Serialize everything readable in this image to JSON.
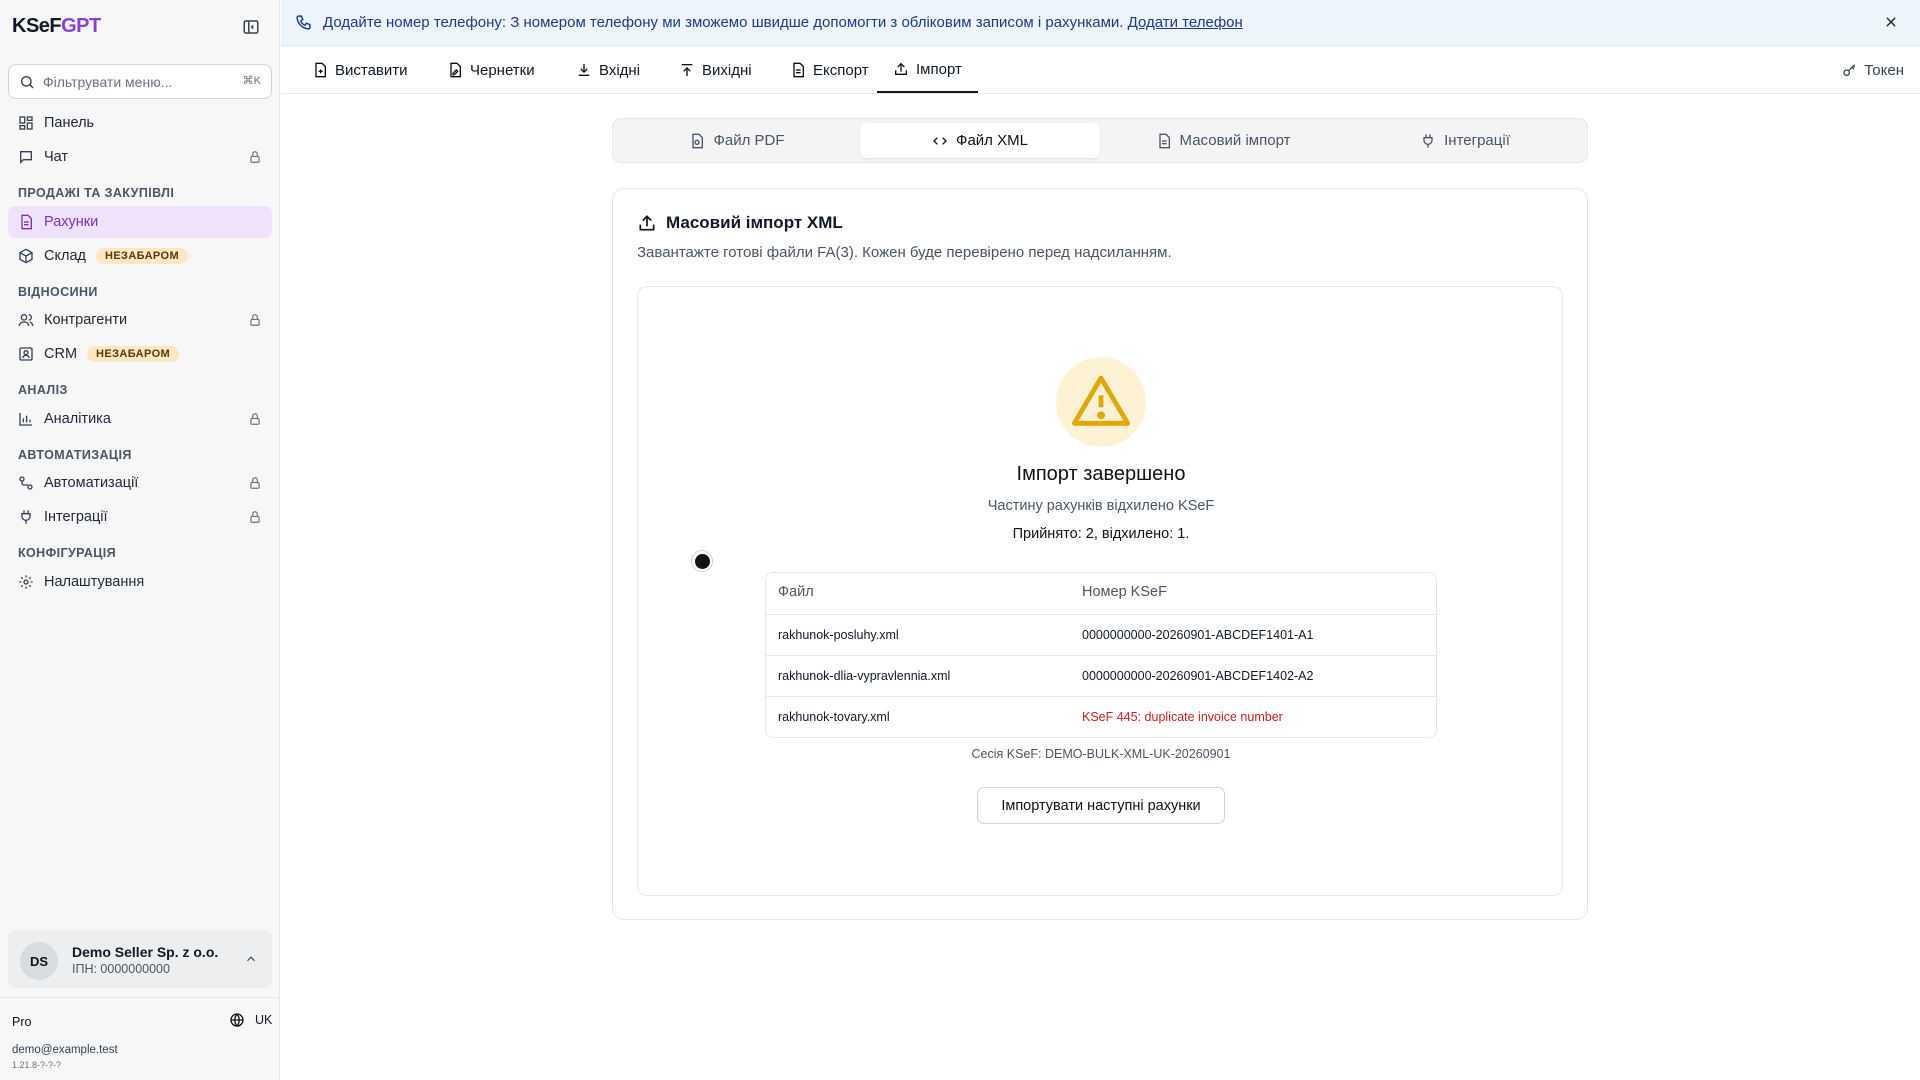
{
  "app": {
    "logo_main": "KSeF",
    "logo_accent": "GPT"
  },
  "search": {
    "placeholder": "Фільтрувати меню...",
    "shortcut": "⌘K"
  },
  "sidebar": {
    "top_items": [
      {
        "label": "Панель",
        "icon": "dashboard-icon",
        "locked": false
      },
      {
        "label": "Чат",
        "icon": "chat-icon",
        "locked": true
      }
    ],
    "sections": [
      {
        "label": "ПРОДАЖІ ТА ЗАКУПІВЛІ",
        "items": [
          {
            "label": "Рахунки",
            "icon": "invoice-icon",
            "active": true
          },
          {
            "label": "Склад",
            "icon": "package-icon",
            "badge": "НЕЗАБАРОМ"
          }
        ]
      },
      {
        "label": "ВІДНОСИНИ",
        "items": [
          {
            "label": "Контрагенти",
            "icon": "users-icon",
            "locked": true
          },
          {
            "label": "CRM",
            "icon": "contact-icon",
            "badge": "НЕЗАБАРОМ"
          }
        ]
      },
      {
        "label": "АНАЛІЗ",
        "items": [
          {
            "label": "Аналітика",
            "icon": "chart-icon",
            "locked": true
          }
        ]
      },
      {
        "label": "АВТОМАТИЗАЦІЯ",
        "items": [
          {
            "label": "Автоматизації",
            "icon": "workflow-icon",
            "locked": true
          },
          {
            "label": "Інтеграції",
            "icon": "plug-icon",
            "locked": true
          }
        ]
      },
      {
        "label": "КОНФІГУРАЦІЯ",
        "items": [
          {
            "label": "Налаштування",
            "icon": "gear-icon",
            "locked": false
          }
        ]
      }
    ]
  },
  "account": {
    "initials": "DS",
    "name": "Demo Seller Sp. z o.o.",
    "nip": "ІПН: 0000000000"
  },
  "footer": {
    "plan": "Pro",
    "language": "UK",
    "email": "demo@example.test",
    "version": "1.21.8-?-?-?"
  },
  "banner": {
    "message": "Додайте номер телефону: З номером телефону ми зможемо швидше допомогти з обліковим записом і рахунками.",
    "link": "Додати телефон"
  },
  "top_tabs": [
    {
      "label": "Виставити",
      "icon": "file-plus-icon",
      "active": false
    },
    {
      "label": "Чернетки",
      "icon": "draft-icon",
      "active": false
    },
    {
      "label": "Вхідні",
      "icon": "download-icon",
      "active": false
    },
    {
      "label": "Вихідні",
      "icon": "upload-icon",
      "active": false
    },
    {
      "label": "Експорт",
      "icon": "file-icon",
      "active": false
    },
    {
      "label": "Імпорт",
      "icon": "import-icon",
      "active": true
    }
  ],
  "token": {
    "label": "Токен"
  },
  "import_tabs": [
    {
      "label": "Файл PDF",
      "icon": "pdf-file-icon",
      "active": false
    },
    {
      "label": "Файл XML",
      "icon": "code-icon",
      "active": true
    },
    {
      "label": "Масовий імпорт",
      "icon": "file-icon",
      "active": false
    },
    {
      "label": "Інтеграції",
      "icon": "plug-icon",
      "active": false
    }
  ],
  "card": {
    "title": "Масовий імпорт XML",
    "description": "Завантажте готові файли FA(3). Кожен буде перевірено перед надсиланням."
  },
  "result": {
    "title": "Імпорт завершено",
    "subtitle": "Частину рахунків відхилено KSeF",
    "counts": "Прийнято: 2, відхилено: 1.",
    "table": {
      "headers": [
        "Файл",
        "Номер KSeF"
      ],
      "rows": [
        {
          "file": "rakhunok-posluhy.xml",
          "ksef": "0000000000-20260901-ABCDEF1401-A1",
          "error": false
        },
        {
          "file": "rakhunok-dlia-vypravlennia.xml",
          "ksef": "0000000000-20260901-ABCDEF1402-A2",
          "error": false
        },
        {
          "file": "rakhunok-tovary.xml",
          "ksef": "KSeF 445: duplicate invoice number",
          "error": true
        }
      ]
    },
    "session": "Сесія KSeF: DEMO-BULK-XML-UK-20260901",
    "button": "Імпортувати наступні рахунки"
  },
  "colors": {
    "accent": "#8b3fd9",
    "active_bg": "#efe3fb",
    "error": "#c81e1e",
    "warning": "#e0a800",
    "badge_bg": "#fde7c2"
  }
}
